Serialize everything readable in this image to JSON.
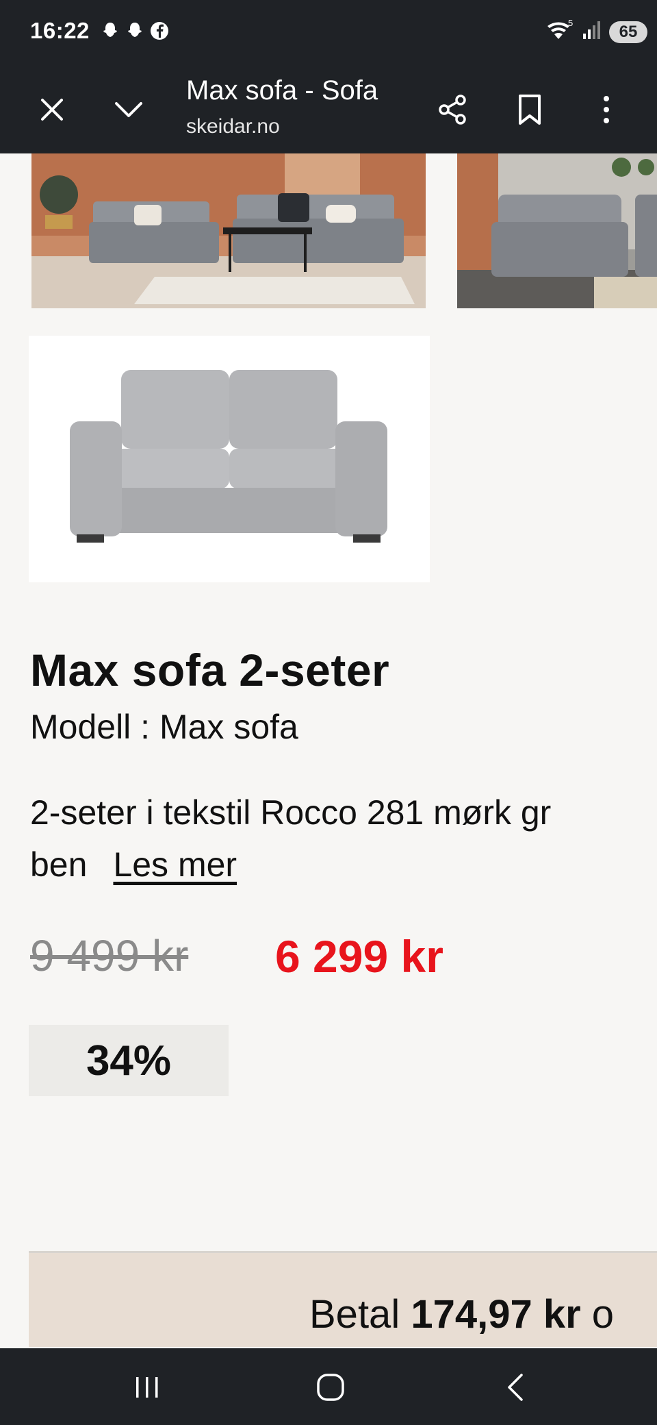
{
  "status_bar": {
    "time": "16:22",
    "battery": "65"
  },
  "browser": {
    "title": "Max sofa - Sofa",
    "url": "skeidar.no"
  },
  "product": {
    "title": "Max sofa 2-seter",
    "model": "Modell : Max sofa",
    "description": "2-seter i tekstil Rocco 281 mørk gr",
    "description_line2": "ben",
    "read_more": "Les mer",
    "old_price": "9 499 kr",
    "new_price": "6 299 kr",
    "discount": "34%"
  },
  "payment": {
    "prefix": "Betal",
    "amount": "174,97 kr",
    "suffix": "o"
  },
  "colors": {
    "accent_red": "#e8141c",
    "dark_bar": "#1f2226",
    "banner": "#e8ddd3"
  },
  "icons": [
    "snapchat-icon",
    "snapchat-icon",
    "facebook-icon",
    "wifi-icon",
    "signal-icon",
    "close-icon",
    "chevron-down-icon",
    "share-icon",
    "bookmark-icon",
    "more-vert-icon",
    "recents-icon",
    "home-icon",
    "back-icon"
  ]
}
